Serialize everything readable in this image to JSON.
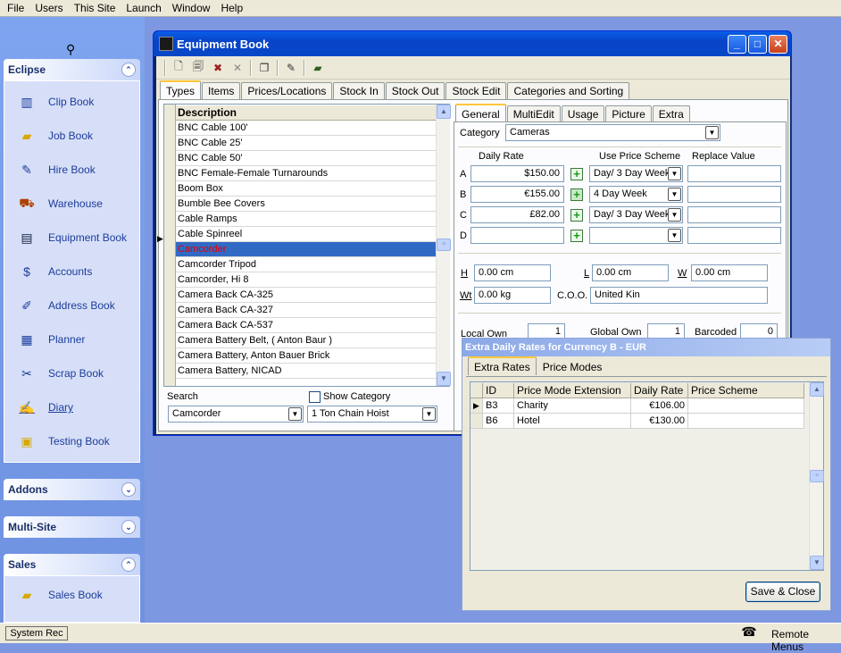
{
  "menubar": {
    "items": [
      "File",
      "Users",
      "This Site",
      "Launch",
      "Window",
      "Help"
    ]
  },
  "leftpanel": {
    "eclipse": {
      "title": "Eclipse",
      "items": [
        {
          "label": "Clip Book",
          "icon": "clip-book-icon"
        },
        {
          "label": "Job Book",
          "icon": "job-book-icon"
        },
        {
          "label": "Hire Book",
          "icon": "hire-book-icon"
        },
        {
          "label": "Warehouse",
          "icon": "warehouse-icon"
        },
        {
          "label": "Equipment Book",
          "icon": "equipment-book-icon"
        },
        {
          "label": "Accounts",
          "icon": "accounts-icon"
        },
        {
          "label": "Address Book",
          "icon": "address-book-icon"
        },
        {
          "label": "Planner",
          "icon": "planner-icon"
        },
        {
          "label": "Scrap Book",
          "icon": "scrap-book-icon"
        },
        {
          "label": "Diary",
          "icon": "diary-icon"
        },
        {
          "label": "Testing Book",
          "icon": "testing-book-icon"
        }
      ]
    },
    "addons": {
      "title": "Addons"
    },
    "multisite": {
      "title": "Multi-Site"
    },
    "sales": {
      "title": "Sales",
      "items": [
        {
          "label": "Sales Book",
          "icon": "sales-book-icon"
        }
      ]
    }
  },
  "statusbar": {
    "system_rec": "System Rec",
    "remote_menus": "Remote Menus"
  },
  "window": {
    "title": "Equipment Book",
    "tabs": [
      "Types",
      "Items",
      "Prices/Locations",
      "Stock In",
      "Stock Out",
      "Stock Edit",
      "Categories and Sorting"
    ],
    "active_tab": "Types",
    "grid": {
      "header": "Description",
      "rows": [
        "BNC Cable 100'",
        "BNC Cable 25'",
        "BNC Cable 50'",
        "BNC Female-Female Turnarounds",
        "Boom Box",
        "Bumble Bee Covers",
        "Cable Ramps",
        "Cable Spinreel",
        "Camcorder",
        "Camcorder Tripod",
        "Camcorder, Hi 8",
        "Camera Back CA-325",
        "Camera Back CA-327",
        "Camera Back CA-537",
        "Camera Battery Belt, ( Anton Baur )",
        "Camera Battery, Anton Bauer Brick",
        "Camera Battery, NICAD"
      ],
      "selected": "Camcorder"
    },
    "search": {
      "label": "Search",
      "value": "Camcorder",
      "show_category_label": "Show Category",
      "category_value": "1 Ton Chain Hoist"
    },
    "detail_tabs": [
      "General",
      "MultiEdit",
      "Usage",
      "Picture",
      "Extra"
    ],
    "general": {
      "category_label": "Category",
      "category_value": "Cameras",
      "daily_rate_label": "Daily Rate",
      "use_price_scheme_label": "Use Price Scheme",
      "replace_value_label": "Replace Value",
      "rates": [
        {
          "letter": "A",
          "value": "$150.00",
          "scheme": "Day/ 3 Day Week"
        },
        {
          "letter": "B",
          "value": "€155.00",
          "scheme": "4 Day Week"
        },
        {
          "letter": "C",
          "value": "£82.00",
          "scheme": "Day/ 3 Day Week"
        },
        {
          "letter": "D",
          "value": "",
          "scheme": ""
        }
      ],
      "h_label": "H",
      "h_value": "0.00 cm",
      "l_label": "L",
      "l_value": "0.00 cm",
      "w_label": "W",
      "w_value": "0.00 cm",
      "wt_label": "Wt",
      "wt_value": "0.00 kg",
      "coo_label": "C.O.O.",
      "coo_value": "United Kin",
      "local_own_label": "Local Own",
      "local_own_value": "1",
      "global_own_label": "Global Own",
      "global_own_value": "1",
      "barcoded_label": "Barcoded",
      "barcoded_value": "0"
    }
  },
  "dialog": {
    "title": "Extra Daily Rates for Currency B - EUR",
    "tabs": [
      "Extra Rates",
      "Price Modes"
    ],
    "columns": [
      "ID",
      "Price Mode Extension",
      "Daily Rate",
      "Price Scheme"
    ],
    "rows": [
      {
        "id": "B3",
        "ext": "Charity",
        "rate": "€106.00",
        "scheme": ""
      },
      {
        "id": "B6",
        "ext": "Hotel",
        "rate": "€130.00",
        "scheme": ""
      }
    ],
    "save_close": "Save & Close"
  }
}
